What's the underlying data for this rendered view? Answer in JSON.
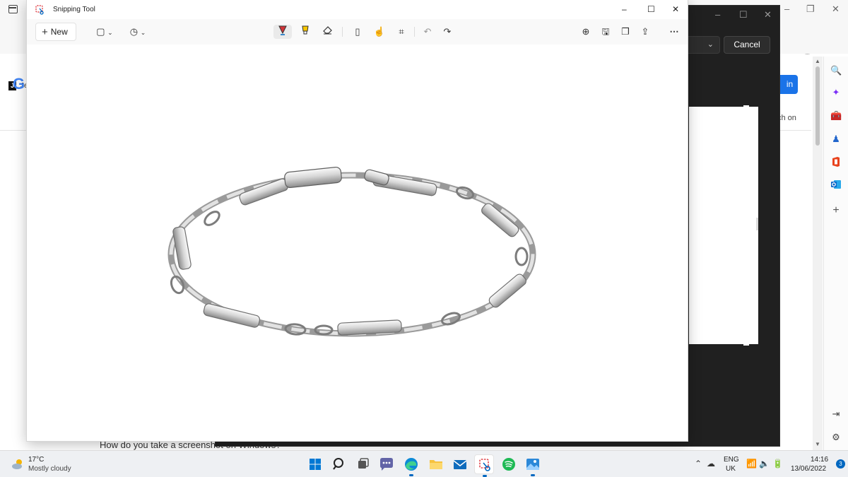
{
  "browser": {
    "bookmark_label": "Je",
    "bookmark_badge": "J",
    "google_letter": "G",
    "signin_label": "in",
    "search_snippet": "ch on",
    "article_text": "How do you take a screenshot on Windows?"
  },
  "dialog": {
    "cancel_label": "Cancel"
  },
  "snipping_tool": {
    "title": "Snipping Tool",
    "new_label": "New",
    "colors": {
      "pen_red": "#d13438",
      "highlighter_yellow": "#f7c600",
      "accent": "#0067c0"
    }
  },
  "taskbar": {
    "weather": {
      "temp": "17°C",
      "condition": "Mostly cloudy"
    },
    "lang": {
      "line1": "ENG",
      "line2": "UK"
    },
    "clock": {
      "time": "14:16",
      "date": "13/06/2022"
    },
    "notification_count": "3",
    "apps": [
      "start-icon",
      "search-icon",
      "task-view-icon",
      "teams-icon",
      "edge-icon",
      "file-explorer-icon",
      "mail-icon",
      "snipping-tool-icon",
      "spotify-icon",
      "photos-icon"
    ]
  }
}
